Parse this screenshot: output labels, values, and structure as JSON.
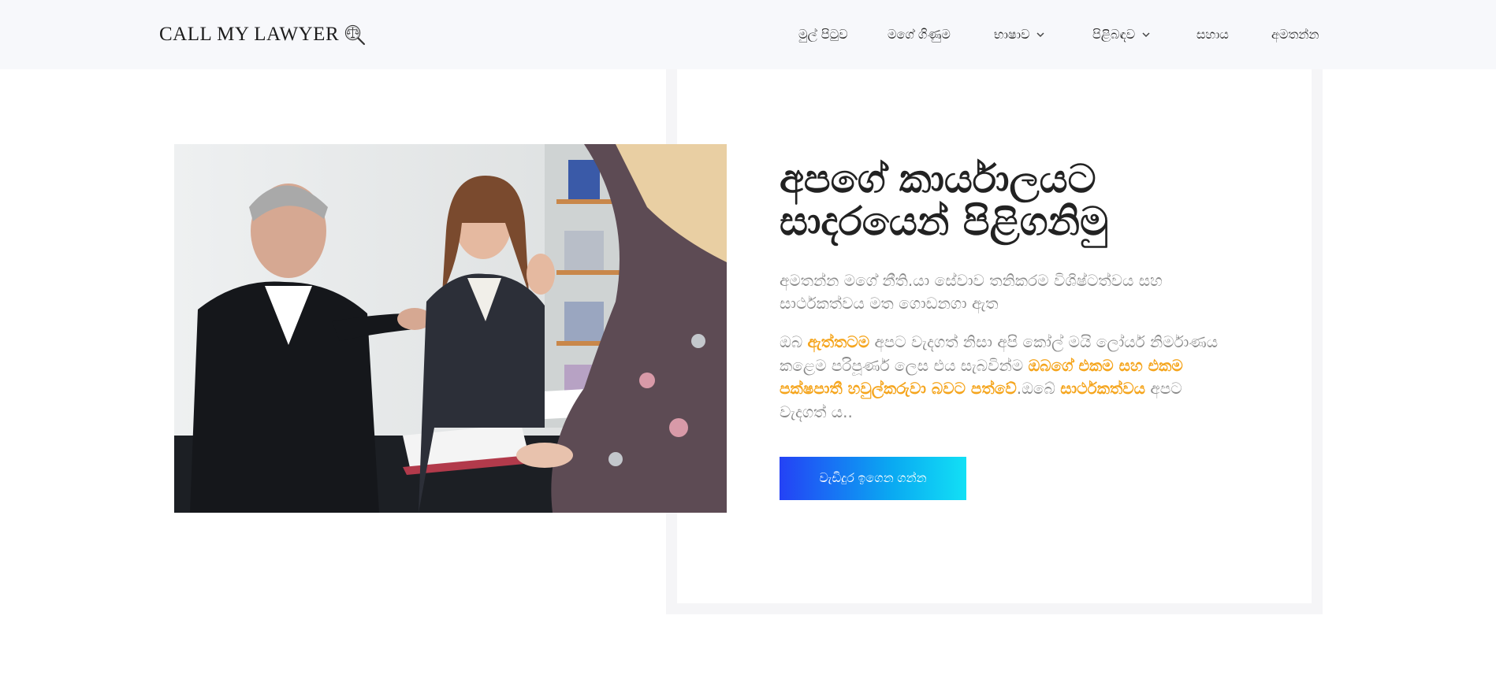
{
  "header": {
    "logo_text": "CALL MY LAWYER",
    "nav": [
      {
        "label": "මුල් පිටුව"
      },
      {
        "label": "මගේ ගිණුම"
      },
      {
        "label": "භාෂාව"
      },
      {
        "label": "පිළිබඳව"
      },
      {
        "label": "සහාය"
      },
      {
        "label": "අමතන්න"
      }
    ]
  },
  "hero": {
    "title_line1": "අපගේ කාර්යාලයට",
    "title_line2": "සාදරයෙන් පිළිගනිමු",
    "subtitle": "අමතන්න මගේ නීති.යා සේවාව තනිකරම විශිෂ්ටත්වය සහ සාර්ථකත්වය මත ගොඩනගා ඇත",
    "body_1": "ඔබ ",
    "body_hl_1": "ඇත්තටම",
    "body_2": " අපට වැදගත් නිසා අපි කෝල් මයි ලෝයර් නිර්මාණය කළෙම පරිපූර්ණ ලෙස එය සැබවින්ම ",
    "body_hl_2": "ඔබගේ එකම සහ එකම පක්ෂපාතී හවුල්කරුවා බවට පත්වේ",
    "body_3": ".ඔබේ ",
    "body_hl_3": "සාර්ථකත්වය",
    "body_4": " අපට වැදගත් ය..",
    "cta_label": "වැඩිදුර ඉගෙන ගන්න"
  },
  "colors": {
    "accent": "#f5a51d",
    "cta_start": "#2442f5",
    "cta_end": "#12e0f5",
    "header_bg": "#f7f8fb"
  },
  "icons": {
    "logo": "scales-magnifier-icon",
    "dropdown": "chevron-down-icon"
  }
}
